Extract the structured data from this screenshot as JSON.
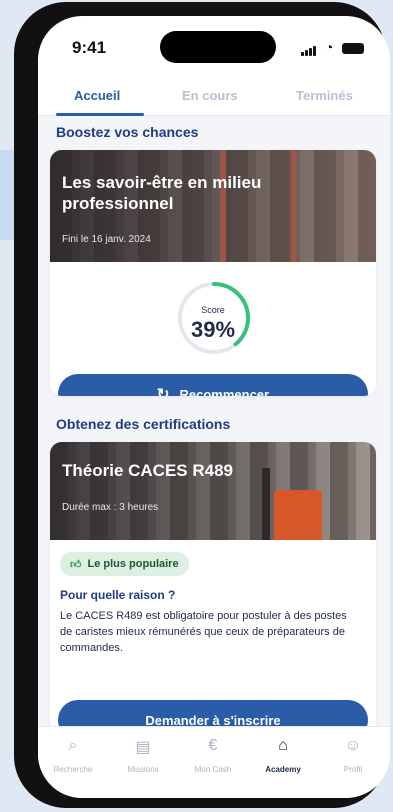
{
  "status": {
    "time": "9:41"
  },
  "tabs": [
    {
      "label": "Accueil",
      "active": true
    },
    {
      "label": "En cours",
      "active": false
    },
    {
      "label": "Terminés",
      "active": false
    }
  ],
  "section1": {
    "title": "Boostez vos chances",
    "card": {
      "title": "Les savoir-être en milieu professionnel",
      "subtitle": "Fini le 16 janv. 2024",
      "score_label": "Score",
      "score_value": "39%",
      "score_progress": 0.39,
      "button_label": "Recommencer",
      "button_icon": "refresh-icon"
    }
  },
  "section2": {
    "title": "Obtenez des certifications",
    "card": {
      "title": "Théorie CACES R489",
      "subtitle": "Durée max : 3 heures",
      "badge": "Le plus populaire",
      "reason_title": "Pour quelle raison ?",
      "reason_text": "Le CACES R489 est obligatoire pour postuler à des postes de caristes mieux rémunérés que ceux de préparateurs de commandes.",
      "button_label": "Demander à s'inscrire"
    }
  },
  "bottom_nav": [
    {
      "label": "Recherche",
      "icon": "search-icon",
      "active": false
    },
    {
      "label": "Missions",
      "icon": "document-icon",
      "active": false
    },
    {
      "label": "Mon Cash",
      "icon": "euro-icon",
      "active": false
    },
    {
      "label": "Academy",
      "icon": "academy-icon",
      "active": true
    },
    {
      "label": "Profil",
      "icon": "user-icon",
      "active": false
    }
  ],
  "colors": {
    "primary": "#2a5ca8",
    "heading": "#1f3d86",
    "score_ring": "#35c27a",
    "badge_bg": "#dcefe2"
  }
}
